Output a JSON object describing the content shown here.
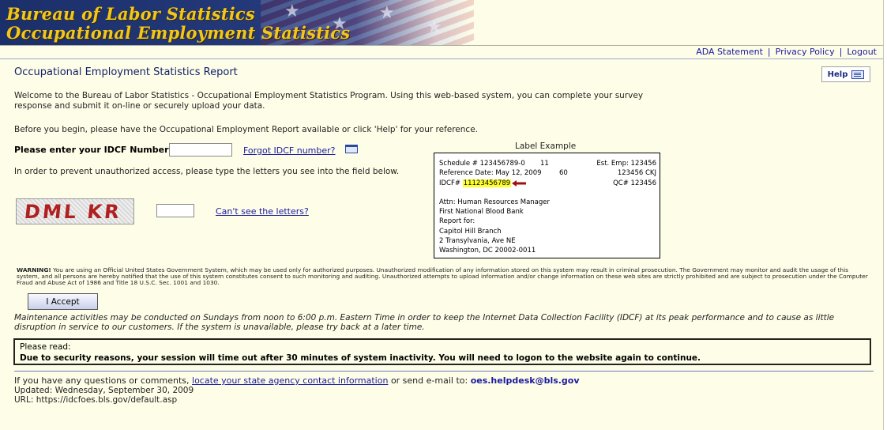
{
  "banner": {
    "title_line1": "Bureau of Labor Statistics",
    "title_line2": "Occupational Employment Statistics"
  },
  "nav": {
    "ada": "ADA Statement",
    "privacy": "Privacy Policy",
    "logout": "Logout",
    "separator": "|"
  },
  "header": {
    "title": "Occupational Employment Statistics Report",
    "help_label": "Help"
  },
  "intro": {
    "text": "Welcome to the Bureau of Labor Statistics - Occupational Employment Statistics Program. Using this web-based system, you can complete your survey response and submit it on-line or securely upload your data.",
    "before_you_begin": "Before you begin, please have the Occupational Employment Report available or click 'Help' for your reference."
  },
  "idcf": {
    "label": "Please enter your IDCF Number:",
    "value": "",
    "forgot_link": "Forgot IDCF number?"
  },
  "captcha": {
    "prompt": "In order to prevent unauthorized access, please type the letters you see into the field below.",
    "image_text": "DML KR",
    "value": "",
    "cant_see_link": "Can't see the letters?"
  },
  "label_example": {
    "caption": "Label Example",
    "schedule": "Schedule # 123456789-0",
    "schedule_num": "11",
    "est_emp": "Est. Emp: 123456",
    "ref_date": "Reference Date: May 12, 2009",
    "ref_num": "60",
    "ckj": "123456 CKJ",
    "idcf_prefix": "IDCF#",
    "idcf_value": "11123456789",
    "qc": "QC# 123456",
    "attn": "Attn: Human Resources Manager",
    "org": "First National Blood Bank",
    "report_for": "Report for:",
    "branch": "Capitol Hill Branch",
    "street": "2 Transylvania, Ave NE",
    "city": "Washington, DC 20002-0011"
  },
  "warning": {
    "label": "WARNING!",
    "text": "You are using an Official United States Government System, which may be used only for authorized purposes. Unauthorized modification of any information stored on this system may result in criminal prosecution. The Government may monitor and audit the usage of this system, and all persons are hereby notified that the use of this system constitutes consent to such monitoring and auditing. Unauthorized attempts to upload information and/or change information on these web sites are strictly prohibited and are subject to prosecution under the Computer Fraud and Abuse Act of 1986 and Title 18 U.S.C. Sec. 1001 and 1030."
  },
  "accept_label": "I Accept",
  "maintenance": "Maintenance activities may be conducted on Sundays from noon to 6:00 p.m. Eastern Time in order to keep the Internet Data Collection Facility (IDCF) at its peak performance and to cause as little disruption in service to our customers. If the system is unavailable, please try back at a later time.",
  "notice": {
    "title": "Please read:",
    "body": "Due to security reasons, your session will time out after 30 minutes of system inactivity. You will need to logon to the website again to continue."
  },
  "footer": {
    "questions_prefix": "If you have any questions or comments,",
    "contact_link": "locate your state agency contact information",
    "email_prefix": "or send e-mail to:",
    "email": "oes.helpdesk@bls.gov",
    "updated": "Updated: Wednesday, September 30, 2009",
    "url": "URL: https://idcfoes.bls.gov/default.asp"
  }
}
